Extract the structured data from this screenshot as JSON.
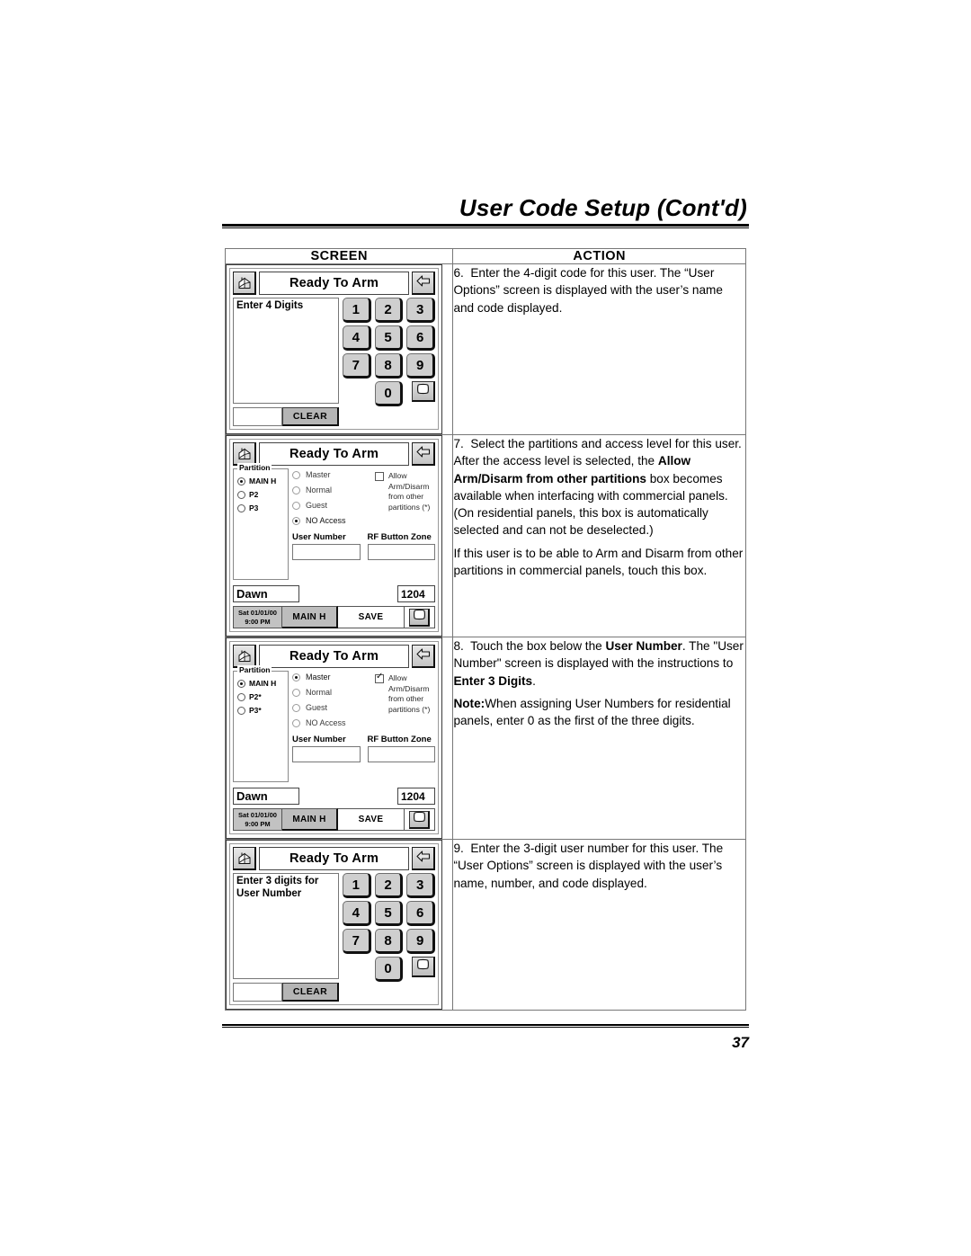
{
  "page": {
    "title": "User Code Setup (Cont'd)",
    "number": "37"
  },
  "table": {
    "headers": {
      "screen": "SCREEN",
      "action": "ACTION"
    }
  },
  "panel_common": {
    "title_bar": "Ready To Arm",
    "home_icon": "house-icon",
    "back_icon": "back-arrow-icon",
    "badge_icon": "badge-icon",
    "keys": [
      "1",
      "2",
      "3",
      "4",
      "5",
      "6",
      "7",
      "8",
      "9"
    ],
    "key_zero": "0",
    "clear_label": "CLEAR"
  },
  "rows": [
    {
      "screen": {
        "kind": "keypad",
        "display_lines": [
          "Enter 4 Digits"
        ]
      },
      "action": {
        "paragraphs": [
          {
            "step": "6.",
            "runs": [
              {
                "t": "Enter the 4-digit code for this user. The “User Options” screen is displayed with the user’s name and code displayed.",
                "b": false
              }
            ]
          }
        ]
      }
    },
    {
      "screen": {
        "kind": "partition",
        "legend": "Partition",
        "partitions": [
          {
            "label": "MAIN H",
            "selected": true
          },
          {
            "label": "P2",
            "selected": false
          },
          {
            "label": "P3",
            "selected": false
          }
        ],
        "levels": [
          {
            "label": "Master",
            "selected": false
          },
          {
            "label": "Normal",
            "selected": false
          },
          {
            "label": "Guest",
            "selected": false
          },
          {
            "label": "NO Access",
            "selected": true
          }
        ],
        "allow": {
          "checked": false,
          "line1": "Allow Arm/Disarm",
          "line2": "from other partitions (*)"
        },
        "fields": [
          {
            "label": "User Number",
            "value": ""
          },
          {
            "label": "RF Button Zone",
            "value": ""
          }
        ],
        "user_name": "Dawn",
        "user_code": "1204",
        "footer": {
          "clock_date": "Sat 01/01/00",
          "clock_time": "9:00 PM",
          "main_label": "MAIN H",
          "save_label": "SAVE"
        }
      },
      "action": {
        "paragraphs": [
          {
            "step": "7.",
            "runs": [
              {
                "t": "Select the partitions and access level for this user. After the access level is selected, the ",
                "b": false
              },
              {
                "t": "Allow Arm/Disarm from other partitions",
                "b": true
              },
              {
                "t": " box becomes available when interfacing with commercial panels. (On residential panels, this box is automatically selected and can not be deselected.)",
                "b": false
              }
            ]
          },
          {
            "step": "",
            "gap": true,
            "runs": [
              {
                "t": "If this user is to be able to Arm and Disarm from other partitions in commercial panels, touch this box.",
                "b": false
              }
            ]
          }
        ]
      }
    },
    {
      "screen": {
        "kind": "partition",
        "legend": "Partition",
        "partitions": [
          {
            "label": "MAIN H",
            "selected": true
          },
          {
            "label": "P2*",
            "selected": false
          },
          {
            "label": "P3*",
            "selected": false
          }
        ],
        "levels": [
          {
            "label": "Master",
            "selected": true
          },
          {
            "label": "Normal",
            "selected": false
          },
          {
            "label": "Guest",
            "selected": false
          },
          {
            "label": "NO Access",
            "selected": false
          }
        ],
        "allow": {
          "checked": true,
          "line1": "Allow Arm/Disarm",
          "line2": "from other partitions (*)"
        },
        "fields": [
          {
            "label": "User Number",
            "value": ""
          },
          {
            "label": "RF Button Zone",
            "value": ""
          }
        ],
        "user_name": "Dawn",
        "user_code": "1204",
        "footer": {
          "clock_date": "Sat 01/01/00",
          "clock_time": "9:00 PM",
          "main_label": "MAIN H",
          "save_label": "SAVE"
        }
      },
      "action": {
        "paragraphs": [
          {
            "step": "8.",
            "runs": [
              {
                "t": "Touch the box below the ",
                "b": false
              },
              {
                "t": "User Number",
                "b": true
              },
              {
                "t": ". The \"User Number\" screen is displayed with the instructions to ",
                "b": false
              },
              {
                "t": "Enter 3 Digits",
                "b": true
              },
              {
                "t": ".",
                "b": false
              }
            ]
          },
          {
            "step": "",
            "gap": true,
            "runs": [
              {
                "t": "Note:",
                "b": true
              },
              {
                "t": "When assigning User Numbers for residential panels, enter 0 as the first of the three digits.",
                "b": false
              }
            ]
          }
        ]
      }
    },
    {
      "screen": {
        "kind": "keypad",
        "display_lines": [
          "Enter 3 digits for",
          "User Number"
        ]
      },
      "action": {
        "paragraphs": [
          {
            "step": "9.",
            "runs": [
              {
                "t": "Enter the 3-digit user number for this user. The “User Options” screen is displayed with the user’s name, number, and code displayed.",
                "b": false
              }
            ]
          }
        ]
      }
    }
  ]
}
